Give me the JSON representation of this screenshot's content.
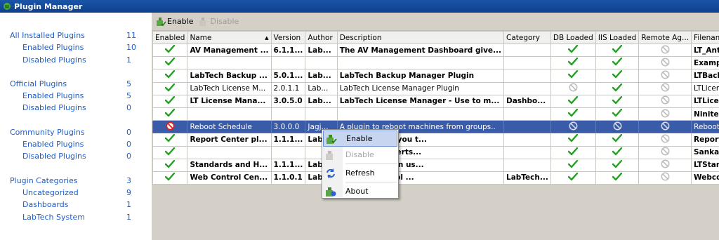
{
  "window": {
    "title": "Plugin Manager"
  },
  "sidebar": {
    "groups": [
      {
        "label": "All Installed Plugins",
        "count": "11",
        "items": [
          {
            "label": "Enabled Plugins",
            "count": "10"
          },
          {
            "label": "Disabled Plugins",
            "count": "1"
          }
        ]
      },
      {
        "label": "Official Plugins",
        "count": "5",
        "items": [
          {
            "label": "Enabled Plugins",
            "count": "5"
          },
          {
            "label": "Disabled Plugins",
            "count": "0"
          }
        ]
      },
      {
        "label": "Community Plugins",
        "count": "0",
        "items": [
          {
            "label": "Enabled Plugins",
            "count": "0"
          },
          {
            "label": "Disabled Plugins",
            "count": "0"
          }
        ]
      },
      {
        "label": "Plugin Categories",
        "count": "3",
        "items": [
          {
            "label": "Uncategorized",
            "count": "9"
          },
          {
            "label": "Dashboards",
            "count": "1"
          },
          {
            "label": "LabTech System",
            "count": "1"
          }
        ]
      }
    ]
  },
  "toolbar": {
    "enable_label": "Enable",
    "disable_label": "Disable"
  },
  "grid": {
    "columns": [
      "Enabled",
      "Name",
      "Version",
      "Author",
      "Description",
      "Category",
      "DB Loaded",
      "IIS Loaded",
      "Remote Ag...",
      "Filename"
    ],
    "rows": [
      {
        "enabled": "check",
        "name": "AV Management ...",
        "version": "6.1.1...",
        "author": "Lab...",
        "description": "The AV Management Dashboard give...",
        "category": "",
        "db": "check",
        "iis": "check",
        "remote": "none",
        "filename": "LT_AntiV...",
        "bold": true
      },
      {
        "enabled": "check",
        "name": "",
        "version": "",
        "author": "",
        "description": "",
        "category": "",
        "db": "check",
        "iis": "check",
        "remote": "none",
        "filename": "Example...",
        "bold": true
      },
      {
        "enabled": "check",
        "name": "LabTech Backup ...",
        "version": "5.0.1...",
        "author": "Lab...",
        "description": "LabTech Backup Manager Plugin",
        "category": "",
        "db": "check",
        "iis": "check",
        "remote": "none",
        "filename": "LTBacku...",
        "bold": true
      },
      {
        "enabled": "check",
        "name": "LabTech License M...",
        "version": "2.0.1.1",
        "author": "Lab...",
        "description": "LabTech License Manager Plugin",
        "category": "",
        "db": "none",
        "iis": "check",
        "remote": "none",
        "filename": "LTLicense...",
        "bold": false
      },
      {
        "enabled": "check",
        "name": "LT License Mana...",
        "version": "3.0.5.0",
        "author": "Lab...",
        "description": "LabTech License Manager - Use to m...",
        "category": "Dashbo...",
        "db": "check",
        "iis": "check",
        "remote": "none",
        "filename": "LTLicens...",
        "bold": true
      },
      {
        "enabled": "check",
        "name": "",
        "version": "",
        "author": "",
        "description": "",
        "category": "",
        "db": "check",
        "iis": "check",
        "remote": "none",
        "filename": "NiniteGo...",
        "bold": true
      },
      {
        "enabled": "none",
        "name": "Reboot Schedule",
        "version": "3.0.0.0",
        "author": "Jagj...",
        "description": "A plugin to reboot machines from groups..",
        "category": "",
        "db": "none",
        "iis": "none",
        "remote": "none",
        "filename": "Reboot Sc...",
        "bold": false,
        "selected": true
      },
      {
        "enabled": "check",
        "name": "Report Center pl...",
        "version": "1.1.1...",
        "author": "Lab...",
        "description": "plugin allows you t...",
        "category": "",
        "db": "check",
        "iis": "check",
        "remote": "none",
        "filename": "ReportC...",
        "bold": true
      },
      {
        "enabled": "check",
        "name": "",
        "version": "",
        "author": "",
        "description": "gin to send alerts...",
        "category": "",
        "db": "check",
        "iis": "check",
        "remote": "none",
        "filename": "SankalpI...",
        "bold": true
      },
      {
        "enabled": "check",
        "name": "Standards and H...",
        "version": "1.1.1...",
        "author": "Labt...",
        "description": "Health solution us...",
        "category": "",
        "db": "check",
        "iis": "check",
        "remote": "none",
        "filename": "LTStand...",
        "bold": true
      },
      {
        "enabled": "check",
        "name": "Web Control Cen...",
        "version": "1.1.0.1",
        "author": "Lab...",
        "description": "ch Web Control ...",
        "category": "LabTech...",
        "db": "check",
        "iis": "check",
        "remote": "none",
        "filename": "Webcont...",
        "bold": true
      }
    ]
  },
  "context_menu": {
    "items": [
      {
        "label": "Enable",
        "icon": "plugin-enable-icon",
        "state": "hover"
      },
      {
        "label": "Disable",
        "icon": "plugin-disable-icon",
        "state": "disabled"
      },
      {
        "label": "Refresh",
        "icon": "refresh-icon",
        "state": "normal"
      },
      {
        "label": "About",
        "icon": "plugin-info-icon",
        "state": "normal"
      }
    ]
  },
  "colors": {
    "accent": "#1f5cc7",
    "selection": "#3a5ba8",
    "check": "#22a020",
    "disabled_icon": "#bcbcbc",
    "error_icon": "#e02020"
  }
}
